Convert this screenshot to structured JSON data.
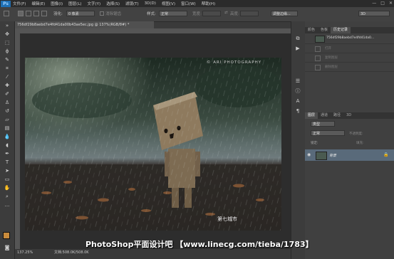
{
  "app": {
    "logo": "Ps"
  },
  "menu": [
    "文件(F)",
    "编辑(E)",
    "图像(I)",
    "图层(L)",
    "文字(Y)",
    "选择(S)",
    "滤镜(T)",
    "3D(D)",
    "视图(V)",
    "窗口(W)",
    "帮助(H)"
  ],
  "options": {
    "feather_label": "羽化:",
    "feather_value": "0 像素",
    "antialias_label": "消除锯齿",
    "style_label": "样式:",
    "style_value": "正常",
    "width_label": "宽度:",
    "height_label": "高度:",
    "refine_edge": "调整边缘...",
    "workspace": "3D"
  },
  "document": {
    "tab_title": "756df29b8aebd7e4fd41da00b43ae5ec.jpg @ 137%(RGB/8#) *",
    "photo_credit": "© ARI PHOTOGRAPHY",
    "signature": "第七城市"
  },
  "status": {
    "zoom": "137.25%",
    "doc_info": "文档:508.0K/508.0K"
  },
  "panels": {
    "top_tabs": [
      "颜色",
      "色板",
      "历史记录"
    ],
    "history_snapshot": "756df29b8aebd7e4fd41da0...",
    "history_items": [
      "打开",
      "复制图层",
      "删除图层"
    ],
    "layers_tabs": [
      "图层",
      "通道",
      "路径",
      "3D"
    ],
    "kind_label": "类型",
    "blend_mode": "正常",
    "opacity_label": "不透明度:",
    "lock_label": "锁定:",
    "fill_label": "填充:",
    "layer_name": "背景"
  },
  "watermark": "PhotoShop平面设计吧  【www.linecg.com/tieba/1783】"
}
